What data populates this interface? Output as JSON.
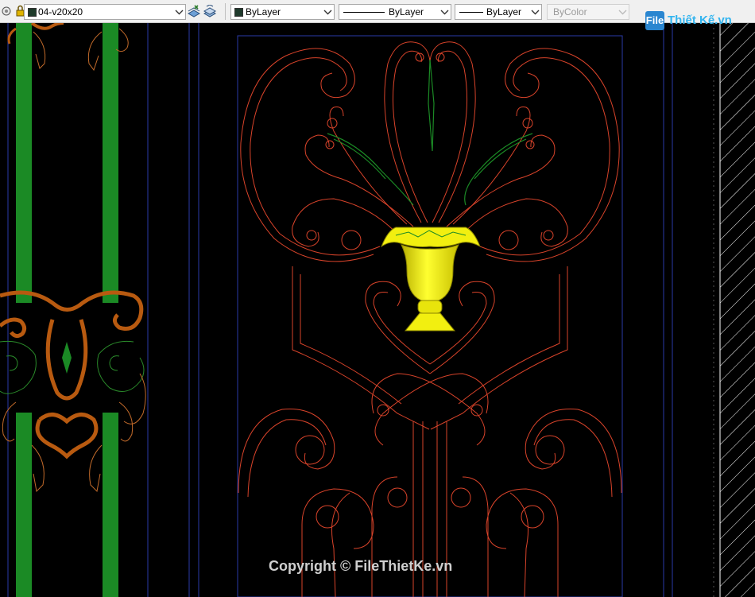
{
  "toolbar": {
    "layer": {
      "value": "04-v20x20",
      "swatch_color": "#1e3a2a"
    },
    "color": {
      "value": "ByLayer",
      "swatch_color": "#1f3a2c"
    },
    "linetype": {
      "value": "ByLayer"
    },
    "lineweight": {
      "value": "ByLayer"
    },
    "plotstyle": {
      "value": "ByColor"
    }
  },
  "watermark": {
    "logo_mark": "File",
    "logo_text": "Thiết Kế.vn",
    "copyright": "Copyright © FileThietKe.vn"
  },
  "colors": {
    "ornament_red": "#d8432a",
    "ornament_green": "#1b8a25",
    "ornament_orange": "#b85a10",
    "vase_yellow": "#f2ef10",
    "frame_blue": "#2a3aa8"
  }
}
